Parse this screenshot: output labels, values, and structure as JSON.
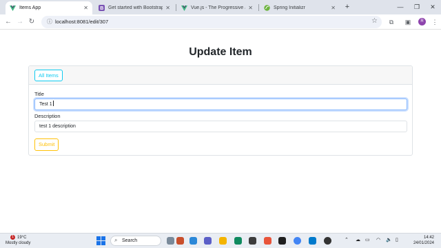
{
  "browser": {
    "tabs": [
      {
        "title": "Items App",
        "active": true,
        "favicon": "vue-logo-icon"
      },
      {
        "title": "Get started with Bootstrap · Bo",
        "active": false,
        "favicon": "bootstrap-logo-icon"
      },
      {
        "title": "Vue.js - The Progressive JavaSc",
        "active": false,
        "favicon": "vue-logo-icon"
      },
      {
        "title": "Spring Initializr",
        "active": false,
        "favicon": "spring-logo-icon"
      }
    ],
    "new_tab": "+",
    "url": "localhost:8081/edit/307",
    "profile_initial": "R"
  },
  "page": {
    "title": "Update Item",
    "all_items_button": "All Items",
    "form": {
      "title_label": "Title",
      "title_value": "Test 1",
      "description_label": "Description",
      "description_value": "test 1 description",
      "submit_label": "Submit"
    }
  },
  "taskbar": {
    "weather": {
      "temp": "19°C",
      "condition": "Mostly cloudy",
      "badge": "1"
    },
    "search_label": "Search",
    "time": "14:42",
    "date": "24/01/2024"
  },
  "colors": {
    "info": "#0dcaf0",
    "warning": "#ffc107",
    "focus": "#86b7fe",
    "tabstrip": "#dfe3eb"
  }
}
